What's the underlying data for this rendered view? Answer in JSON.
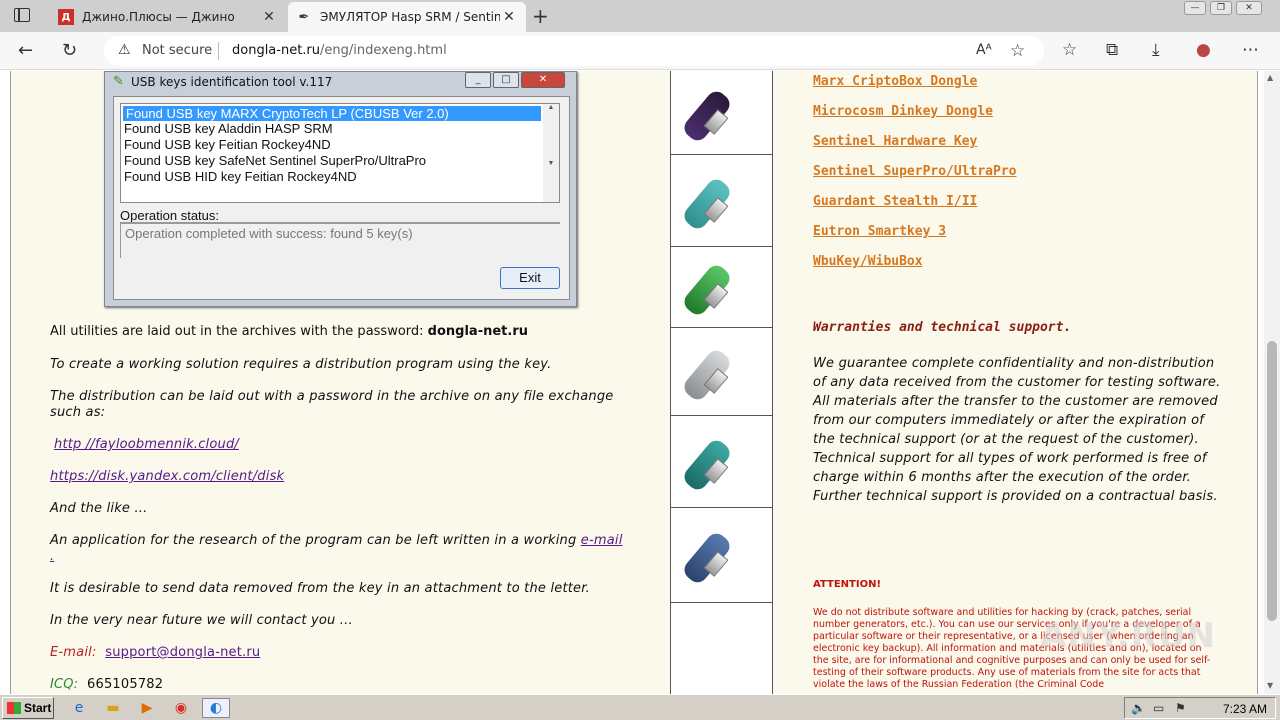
{
  "browser": {
    "tabs": [
      {
        "title": "Джино.Плюсы — Джино",
        "favicon": "Д",
        "favicon_color": "#c8312a",
        "active": false
      },
      {
        "title": "ЭМУЛЯТОР Hasp SRM / Sentinel",
        "favicon": "✒",
        "favicon_color": "#333333",
        "active": true
      }
    ],
    "not_secure": "Not secure",
    "url_host": "dongla-net.ru",
    "url_path": "/eng/indexeng.html"
  },
  "dialog": {
    "title": "USB keys identification tool v.117",
    "keys": [
      "Found USB key MARX  CryptoTech LP (CBUSB Ver 2.0)",
      "Found USB key Aladdin  HASP SRM",
      "Found USB key Feitian  Rockey4ND",
      "Found USB key SafeNet  Sentinel SuperPro/UltraPro",
      "Found USB HID key Feitian  Rockey4ND"
    ],
    "operation_label": "Operation status:",
    "operation_status": "Operation completed with success: found 5 key(s)",
    "exit_label": "Exit"
  },
  "left": {
    "archives_text": "All utilities are laid out in the archives with the password: ",
    "archives_password": "dongla-net.ru",
    "distribution_program": "To create a working solution requires a distribution program using the key.",
    "distribution_exchange": "The distribution can be laid out with a password in the archive on any file exchange such as:",
    "link1": "http //fayloobmennik.cloud/",
    "link2": "https://disk.yandex.com/client/disk",
    "and_like": "And the like ...",
    "application_text": "An application for the research of the program can be left written in a working ",
    "application_link": "e-mail",
    "application_dot": ".",
    "desirable": "It is desirable to send data removed from the key in an attachment to the letter.",
    "contact": "In the very near future we will contact you ...",
    "email_label": "E-mail:",
    "email_value": "support@dongla-net.ru",
    "icq_label": "ICQ:",
    "icq_value": "665105782"
  },
  "dongles": [
    {
      "name": "marx-dongle",
      "color": "#2a1a3a",
      "accent": "#9b59d0"
    },
    {
      "name": "teal-dongle",
      "color": "#3fa9a8",
      "accent": "#2f8f8e"
    },
    {
      "name": "green-dongle",
      "color": "#1f7a2a",
      "accent": "#5cc86a"
    },
    {
      "name": "silver-dongle",
      "color": "#b9bcc0",
      "accent": "#8a8d91"
    },
    {
      "name": "teal-dongle-2",
      "color": "#2a8a86",
      "accent": "#1b6a66"
    },
    {
      "name": "blue-dongle",
      "color": "#3e5d90",
      "accent": "#2b446e"
    }
  ],
  "right": {
    "links": [
      "Marx CriptoBox Dongle",
      "Microcosm Dinkey Dongle",
      "Sentinel Hardware Key",
      "Sentinel SuperPro/UltraPro",
      "Guardant Stealth I/II",
      "Eutron Smartkey 3",
      "WbuKey/WibuBox"
    ],
    "warranty_title": "Warranties and technical support.",
    "guarantee_text": "We guarantee complete confidentiality and non-distribution of any data received from the customer for testing software.",
    "materials_text": "All materials after the transfer to the customer are removed from our computers immediately or after the expiration of the technical support (or at the request of the customer).",
    "support_text": "Technical support for all types of work performed is free of charge within 6 months after the execution of the order. Further technical support is provided on a contractual basis.",
    "attention": "ATTENTION!",
    "disclaimer": "We do not distribute software and utilities for hacking by (crack, patches, serial number generators, etc.). You can use our services only if you're a developer of a particular software or their representative, or a licensed user (when ordering an electronic key backup). All information and materials (utilities and on), located on the site, are for informational and cognitive purposes and can only be used for self-testing of their software products. Any use of materials from the site for acts that violate the laws of the Russian Federation (the Criminal Code",
    "watermark": "ANY.RUN"
  },
  "taskbar": {
    "start": "Start",
    "clock": "7:23 AM"
  },
  "colors": {
    "page_bg": "#fbf8ec",
    "link_orange": "#d8781e",
    "attention_red": "#c0140a"
  }
}
